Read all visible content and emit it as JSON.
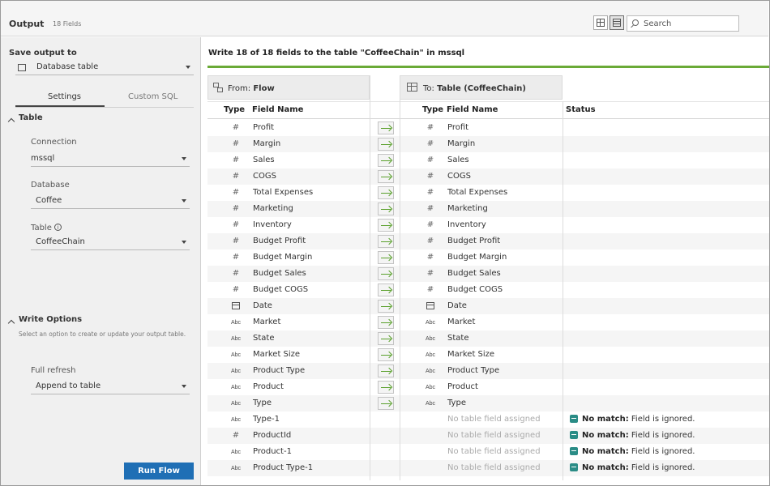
{
  "header": {
    "title": "Output",
    "field_count": "18 Fields",
    "search_placeholder": "Search",
    "view_icons": [
      "grid-view-icon",
      "list-view-icon"
    ]
  },
  "left_panel": {
    "save_output_label": "Save output to",
    "save_output_value": "Database table",
    "tabs": [
      "Settings",
      "Custom SQL"
    ],
    "active_tab": "Settings",
    "table_section": {
      "title": "Table",
      "connection_label": "Connection",
      "connection_value": "mssql",
      "database_label": "Database",
      "database_value": "Coffee",
      "table_label": "Table",
      "table_value": "CoffeeChain"
    },
    "write_section": {
      "title": "Write Options",
      "description": "Select an option to create or update your output table.",
      "refresh_label": "Full refresh",
      "refresh_value": "Append to table"
    },
    "run_button": "Run Flow"
  },
  "main": {
    "summary": "Write 18 of 18 fields to the table \"CoffeeChain\" in mssql",
    "from_header": {
      "prefix": "From: ",
      "name": "Flow"
    },
    "to_header": {
      "prefix": "To: ",
      "name": "Table (CoffeeChain)"
    },
    "columns": {
      "type": "Type",
      "field_name": "Field Name",
      "status": "Status"
    },
    "colors": {
      "accent": "#6aaa37",
      "run_button": "#1f6fb5",
      "ignored_icon": "#2a8c86"
    },
    "rows": [
      {
        "src_type": "#",
        "src_name": "Profit",
        "mapped": true,
        "dst_type": "#",
        "dst_name": "Profit",
        "status_bold": "",
        "status_text": ""
      },
      {
        "src_type": "#",
        "src_name": "Margin",
        "mapped": true,
        "dst_type": "#",
        "dst_name": "Margin",
        "status_bold": "",
        "status_text": ""
      },
      {
        "src_type": "#",
        "src_name": "Sales",
        "mapped": true,
        "dst_type": "#",
        "dst_name": "Sales",
        "status_bold": "",
        "status_text": ""
      },
      {
        "src_type": "#",
        "src_name": "COGS",
        "mapped": true,
        "dst_type": "#",
        "dst_name": "COGS",
        "status_bold": "",
        "status_text": ""
      },
      {
        "src_type": "#",
        "src_name": "Total Expenses",
        "mapped": true,
        "dst_type": "#",
        "dst_name": "Total Expenses",
        "status_bold": "",
        "status_text": ""
      },
      {
        "src_type": "#",
        "src_name": "Marketing",
        "mapped": true,
        "dst_type": "#",
        "dst_name": "Marketing",
        "status_bold": "",
        "status_text": ""
      },
      {
        "src_type": "#",
        "src_name": "Inventory",
        "mapped": true,
        "dst_type": "#",
        "dst_name": "Inventory",
        "status_bold": "",
        "status_text": ""
      },
      {
        "src_type": "#",
        "src_name": "Budget Profit",
        "mapped": true,
        "dst_type": "#",
        "dst_name": "Budget Profit",
        "status_bold": "",
        "status_text": ""
      },
      {
        "src_type": "#",
        "src_name": "Budget Margin",
        "mapped": true,
        "dst_type": "#",
        "dst_name": "Budget Margin",
        "status_bold": "",
        "status_text": ""
      },
      {
        "src_type": "#",
        "src_name": "Budget Sales",
        "mapped": true,
        "dst_type": "#",
        "dst_name": "Budget Sales",
        "status_bold": "",
        "status_text": ""
      },
      {
        "src_type": "#",
        "src_name": "Budget COGS",
        "mapped": true,
        "dst_type": "#",
        "dst_name": "Budget COGS",
        "status_bold": "",
        "status_text": ""
      },
      {
        "src_type": "date",
        "src_name": "Date",
        "mapped": true,
        "dst_type": "date",
        "dst_name": "Date",
        "status_bold": "",
        "status_text": ""
      },
      {
        "src_type": "Abc",
        "src_name": "Market",
        "mapped": true,
        "dst_type": "Abc",
        "dst_name": "Market",
        "status_bold": "",
        "status_text": ""
      },
      {
        "src_type": "Abc",
        "src_name": "State",
        "mapped": true,
        "dst_type": "Abc",
        "dst_name": "State",
        "status_bold": "",
        "status_text": ""
      },
      {
        "src_type": "Abc",
        "src_name": "Market Size",
        "mapped": true,
        "dst_type": "Abc",
        "dst_name": "Market Size",
        "status_bold": "",
        "status_text": ""
      },
      {
        "src_type": "Abc",
        "src_name": "Product Type",
        "mapped": true,
        "dst_type": "Abc",
        "dst_name": "Product Type",
        "status_bold": "",
        "status_text": ""
      },
      {
        "src_type": "Abc",
        "src_name": "Product",
        "mapped": true,
        "dst_type": "Abc",
        "dst_name": "Product",
        "status_bold": "",
        "status_text": ""
      },
      {
        "src_type": "Abc",
        "src_name": "Type",
        "mapped": true,
        "dst_type": "Abc",
        "dst_name": "Type",
        "status_bold": "",
        "status_text": ""
      },
      {
        "src_type": "Abc",
        "src_name": "Type-1",
        "mapped": false,
        "dst_type": "",
        "dst_name": "No table field assigned",
        "status_bold": "No match:",
        "status_text": " Field is ignored."
      },
      {
        "src_type": "#",
        "src_name": "ProductId",
        "mapped": false,
        "dst_type": "",
        "dst_name": "No table field assigned",
        "status_bold": "No match:",
        "status_text": " Field is ignored."
      },
      {
        "src_type": "Abc",
        "src_name": "Product-1",
        "mapped": false,
        "dst_type": "",
        "dst_name": "No table field assigned",
        "status_bold": "No match:",
        "status_text": " Field is ignored."
      },
      {
        "src_type": "Abc",
        "src_name": "Product Type-1",
        "mapped": false,
        "dst_type": "",
        "dst_name": "No table field assigned",
        "status_bold": "No match:",
        "status_text": " Field is ignored."
      }
    ]
  }
}
